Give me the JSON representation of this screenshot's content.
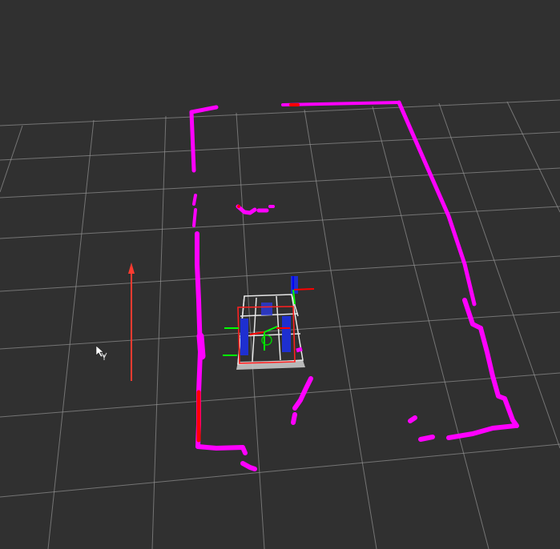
{
  "viewer": {
    "background_color": "#303030",
    "grid_color": "#a0a0a0",
    "scan_color": "#ff00ff",
    "scan_highlight_color": "#ff0000",
    "goal_arrow_color": "#ff3b30",
    "robot_frame_color": "#ffffff",
    "robot_body_color": "#1e2fd0",
    "axis_x_color": "#ff0000",
    "axis_y_color": "#00ff00",
    "axis_z_color": "#0000ff",
    "cursor_icon": "move-cursor-icon"
  }
}
